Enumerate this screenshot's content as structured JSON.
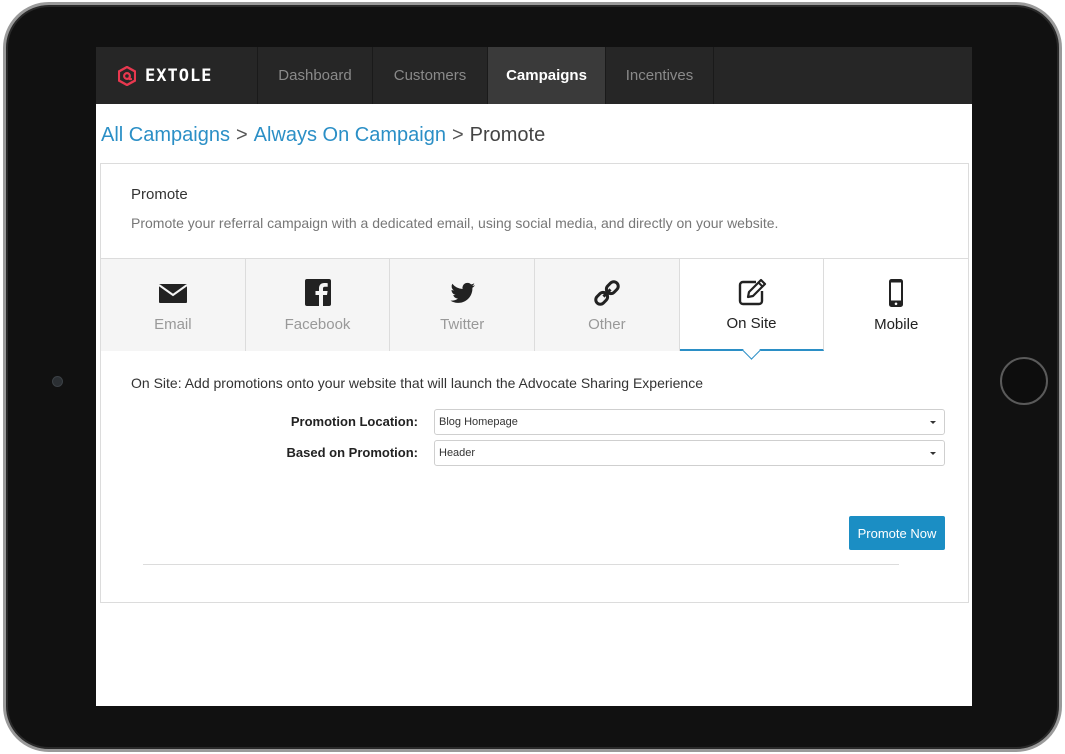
{
  "brand": {
    "name": "EXTOLE",
    "color": "#e8384f"
  },
  "nav": {
    "items": [
      {
        "label": "Dashboard",
        "active": false
      },
      {
        "label": "Customers",
        "active": false
      },
      {
        "label": "Campaigns",
        "active": true
      },
      {
        "label": "Incentives",
        "active": false
      }
    ]
  },
  "breadcrumb": {
    "items": [
      "All Campaigns",
      "Always On Campaign",
      "Promote"
    ],
    "separator": ">"
  },
  "promote": {
    "title": "Promote",
    "description": "Promote your referral campaign with a dedicated email, using social media, and directly on your website."
  },
  "tabs": [
    {
      "label": "Email",
      "icon": "envelope-icon",
      "active": false
    },
    {
      "label": "Facebook",
      "icon": "facebook-icon",
      "active": false
    },
    {
      "label": "Twitter",
      "icon": "twitter-icon",
      "active": false
    },
    {
      "label": "Other",
      "icon": "link-icon",
      "active": false
    },
    {
      "label": "On Site",
      "icon": "edit-icon",
      "active": true
    },
    {
      "label": "Mobile",
      "icon": "mobile-phone-icon",
      "active": false
    }
  ],
  "on_site": {
    "description": "On Site: Add promotions onto your website that will launch the Advocate Sharing Experience",
    "promotion_location": {
      "label": "Promotion Location:",
      "value": "Blog Homepage"
    },
    "based_on_promotion": {
      "label": "Based on Promotion:",
      "value": "Header"
    },
    "promote_button": "Promote Now"
  },
  "colors": {
    "accent": "#1b8ec4",
    "link": "#2b8fc6",
    "nav_bg": "#262626"
  }
}
